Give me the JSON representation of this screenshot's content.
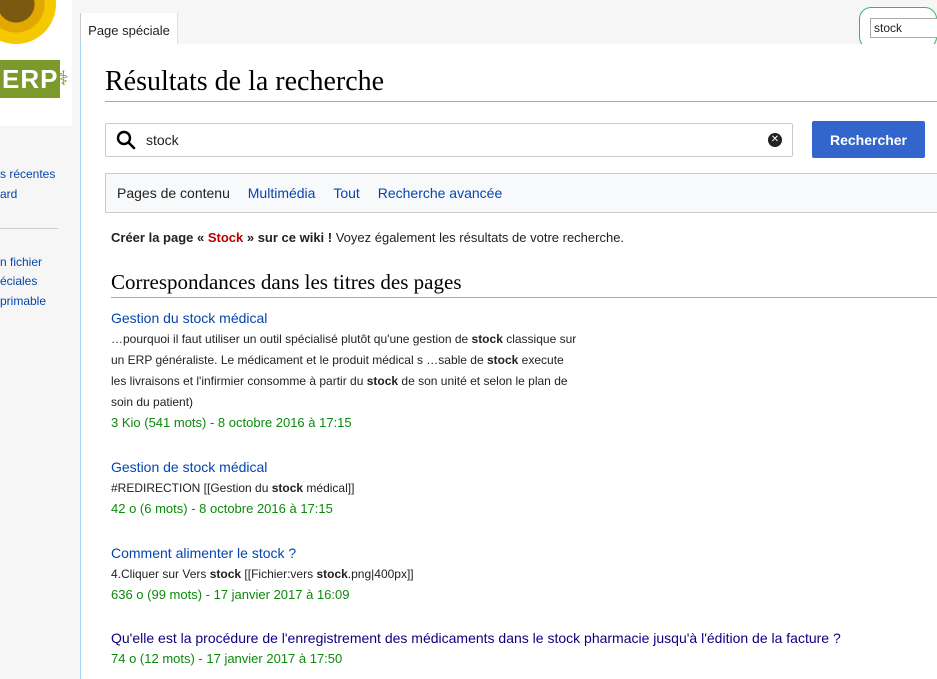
{
  "sidebar": {
    "logo_text": "ERP",
    "links": [
      "s récentes",
      "ard",
      "n fichier",
      "éciales",
      "primable"
    ]
  },
  "tab": {
    "label": "Page spéciale"
  },
  "top_search": {
    "value": "stock"
  },
  "heading": "Résultats de la recherche",
  "search": {
    "query": "stock",
    "button_label": "Rechercher"
  },
  "profiles": {
    "current": "Pages de contenu",
    "links": [
      "Multimédia",
      "Tout",
      "Recherche avancée"
    ]
  },
  "create_notice": {
    "prefix": "Créer la page « ",
    "page": "Stock",
    "suffix": " » sur ce wiki !",
    "rest": " Voyez également les résultats de votre recherche."
  },
  "section_title": "Correspondances dans les titres des pages",
  "results": [
    {
      "title": "Gestion du stock médical",
      "snippet_lines": [
        [
          "…pourquoi il faut utiliser un outil spécialisé plutôt qu'une gestion de ",
          "stock",
          " classique sur"
        ],
        [
          "un ERP généraliste. Le médicament et le produit médical s …sable de ",
          "stock",
          " execute"
        ],
        [
          "les livraisons et l'infirmier consomme à partir du ",
          "stock",
          " de son unité et selon le plan de"
        ],
        [
          "soin du patient)",
          "",
          ""
        ]
      ],
      "meta": "3 Kio (541 mots) - 8 octobre 2016 à 17:15"
    },
    {
      "title": "Gestion de stock médical",
      "snippet_lines": [
        [
          "#REDIRECTION [[Gestion du ",
          "stock",
          " médical]]"
        ]
      ],
      "meta": "42 o (6 mots) - 8 octobre 2016 à 17:15"
    },
    {
      "title": "Comment alimenter le stock ?",
      "snippet_lines": [
        [
          "4.Cliquer sur Vers ",
          "stock",
          " [[Fichier:vers ",
          "stock",
          ".png|400px]]"
        ]
      ],
      "meta": "636 o (99 mots) - 17 janvier 2017 à 16:09"
    },
    {
      "title": "Qu'elle est la procédure de l'enregistrement des médicaments dans le stock pharmacie jusqu'à l'édition de la facture ?",
      "snippet_lines": [],
      "meta": "74 o (12 mots) - 17 janvier 2017 à 17:50"
    }
  ],
  "colors": {
    "link": "#0645ad",
    "visited": "#0b0080",
    "meta": "#0b8a0b",
    "button": "#3366cc",
    "redlink": "#ba0000"
  }
}
